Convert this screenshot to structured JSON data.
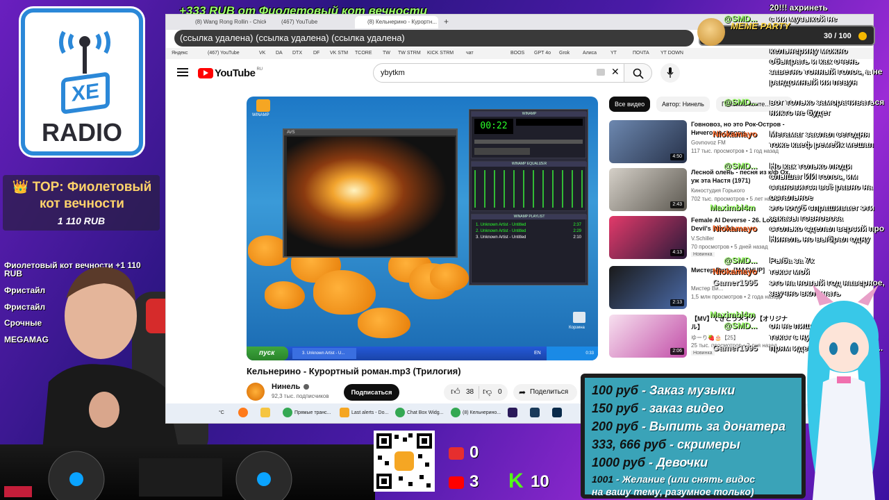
{
  "donation_banner": "+333 RUB  от Фиолетовый кот вечности",
  "logo": {
    "main": "XE",
    "sub": "RADIO"
  },
  "top_donor": {
    "title": "👑 TOP: Фиолетовый кот вечности",
    "amount": "1 110 RUB"
  },
  "recent_donations": [
    "Фиолетовый кот вечности +1 110 RUB",
    "Фристайл",
    "Фристайл",
    "Срочные",
    "MEGAMAG"
  ],
  "browser": {
    "tabs": [
      "(8) Wang Rong Rollin - Chick C...",
      "(467) YouTube",
      "(8) Кельнерино - Курортн..."
    ],
    "address": "(ссылка удалена) (ссылка удалена) (ссылка удалена)",
    "bookmarks": [
      "Яндекс",
      "(467) YouTube",
      "VK",
      "DA",
      "DTX",
      "DF",
      "VK STM",
      "TCORE",
      "TW",
      "TW STRM",
      "KICK STRM",
      "чат",
      "BOOS",
      "GPT 4o",
      "Grok",
      "Алиса",
      "YT",
      "ПОЧТА",
      "YT DOWN"
    ]
  },
  "youtube": {
    "logo": "YouTube",
    "logo_region": "RU",
    "search_value": "ybytkm",
    "chips": [
      "Все видео",
      "Автор: Нинель",
      "Похожие конте..."
    ],
    "video": {
      "title": "Кельнерино - Курортный роман.mp3 (Трилогия)",
      "channel": "Нинель",
      "subscribers": "92,3 тыс. подписчиков",
      "subscribe_label": "Подписаться",
      "likes": "38",
      "dislikes": "0",
      "share_label": "Поделиться"
    },
    "player": {
      "avs_title": "AVS",
      "winamp_title": "WINAMP",
      "time": "00:22",
      "eq_title": "WINAMP EQUALIZER",
      "playlist_title": "WINAMP PLAYLIST",
      "playlist": [
        {
          "name": "1. Unknown Artist - Untitled",
          "dur": "2:37"
        },
        {
          "name": "2. Unknown Artist - Untitled",
          "dur": "2:29"
        },
        {
          "name": "3. Unknown Artist - Untitled",
          "dur": "2:10"
        }
      ],
      "start_label": "пуск",
      "task_label": "3. Unknown Artist - U...",
      "lang": "EN",
      "clock": "0:33",
      "desktop_icon": "WINAMP",
      "recycle": "Корзина"
    },
    "recommendations": [
      {
        "title": "Говновоз, но это Рок-Остров - Ничего не говори",
        "channel": "Govnovoz FM",
        "meta": "117 тыс. просмотров • 1 год назад",
        "duration": "4:50",
        "new": ""
      },
      {
        "title": "Лесной олень - песня из к/ф Ох, уж эта Настя (1971)",
        "channel": "Киностудия Горького",
        "meta": "702 тыс. просмотров • 5 лет назад",
        "duration": "2:43",
        "new": ""
      },
      {
        "title": "Female AI Deverse - 26. Love Devil's Devilsh...",
        "channel": "V.Schiller",
        "meta": "70 просмотров • 5 дней назад",
        "duration": "4:13",
        "new": "Новинка"
      },
      {
        "title": "Мистер Вит... [MASHUP]",
        "channel": "Мистер Ви...",
        "meta": "1,5 млн просмотров • 2 года назад",
        "duration": "2:13",
        "new": ""
      },
      {
        "title": "【MV】てきとうメイク【オリジナル】",
        "channel": "ゆーり🍓🎂【25】",
        "meta": "25 тыс. просмотров • 2 дня назад",
        "duration": "2:06",
        "new": "Новинка"
      }
    ]
  },
  "os_taskbar": {
    "weather": "°C",
    "items": [
      "Прямые транс...",
      "Last alerts - Do...",
      "Chat Box Widg...",
      "(8) Кельнерино..."
    ]
  },
  "meme_party": {
    "label": "MEME PARTY",
    "count": "30 / 100"
  },
  "chat": [
    {
      "user": "",
      "msg": "20!!! ахринеть"
    },
    {
      "user": "@SMD...",
      "msg": "с ии музыкой не"
    },
    {
      "user": "@SMD...",
      "msg": "кельнерину можно обыграть и как очень заветно тонный голос, а не рандомный ии певун"
    },
    {
      "user": "@SMD...",
      "msg": "вот только заморачиваться никто не будет"
    },
    {
      "user": "Niokamayo",
      "msg": "Мегамаг заслал сегодня тоже каеф ремейк мешап"
    },
    {
      "user": "@SMD...",
      "msg": "Но как только люди слышат ИИ голос, им становится всё равно на остальное"
    },
    {
      "user": "Maximbl4m",
      "msg": "это ютуб спрашивает эти заказы говновоза"
    },
    {
      "user": "Niokamayo",
      "msg": "столько сделал версий про Нинель но выбрал одну"
    },
    {
      "user": "@SMD...",
      "msg": "Рыба за 7к"
    },
    {
      "user": "Niokamayo",
      "msg": "текст мой"
    },
    {
      "user": "Gamer1995",
      "msg": "это на новый год наверное, звучно включать"
    },
    {
      "user": "Maximbl4m",
      "msg": "он не пиш..."
    },
    {
      "user": "@SMD...",
      "msg": "текст с нуля"
    },
    {
      "user": "Gamer1995",
      "msg": "прям идеаль... музыкой и..."
    }
  ],
  "price_list": [
    {
      "num": "100 руб",
      "text": " - Заказ музыки"
    },
    {
      "num": "150 руб",
      "text": " - заказ видео"
    },
    {
      "num": "200 руб",
      "text": " - Выпить за донатера"
    },
    {
      "num": "333, 666 руб",
      "text": " - скримеры"
    },
    {
      "num": "1000 руб",
      "text": " - Девочки"
    },
    {
      "num": "1001",
      "text": " - Желание (или снять видос"
    },
    {
      "num": "",
      "text": "на вашу тему, разумное только)"
    }
  ],
  "stats": {
    "live": "0",
    "youtube": "3",
    "kick": "10"
  },
  "colors": {
    "accent_green": "#9cff6a",
    "youtube_red": "#ff0000",
    "panel": "#3aa3b8"
  }
}
